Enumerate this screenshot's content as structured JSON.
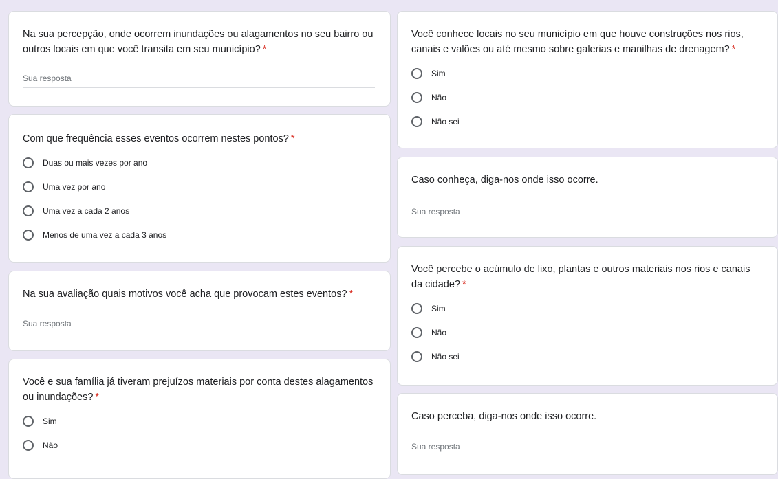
{
  "required_mark": "*",
  "colors": {
    "background": "#eae6f4",
    "card": "#ffffff",
    "required": "#d93025",
    "radio_border": "#5f6368"
  },
  "left": {
    "q1": {
      "text": "Na sua percepção, onde ocorrem inundações ou alagamentos no seu bairro ou outros locais em que você transita em seu município?",
      "placeholder": "Sua resposta"
    },
    "q2": {
      "text": "Com que frequência esses eventos ocorrem nestes pontos?",
      "options": [
        "Duas ou mais vezes por ano",
        "Uma vez por ano",
        "Uma vez a cada 2 anos",
        "Menos de uma vez a cada 3 anos"
      ]
    },
    "q3": {
      "text": "Na sua avaliação quais motivos você acha que provocam estes eventos?",
      "placeholder": "Sua resposta"
    },
    "q4": {
      "text": "Você e sua família já tiveram prejuízos materiais por conta destes alagamentos ou inundações?",
      "options": [
        "Sim",
        "Não"
      ]
    }
  },
  "right": {
    "q5": {
      "text": "Você conhece locais no seu município em que houve construções nos rios, canais e valões ou até mesmo sobre galerias e manilhas de drenagem?",
      "options": [
        "Sim",
        "Não",
        "Não sei"
      ]
    },
    "q6": {
      "text": "Caso conheça, diga-nos onde isso ocorre.",
      "placeholder": "Sua resposta"
    },
    "q7": {
      "text": "Você percebe o acúmulo de lixo, plantas e outros materiais nos rios e canais da cidade?",
      "options": [
        "Sim",
        "Não",
        "Não sei"
      ]
    },
    "q8": {
      "text": "Caso perceba, diga-nos onde isso ocorre.",
      "placeholder": "Sua resposta"
    }
  }
}
